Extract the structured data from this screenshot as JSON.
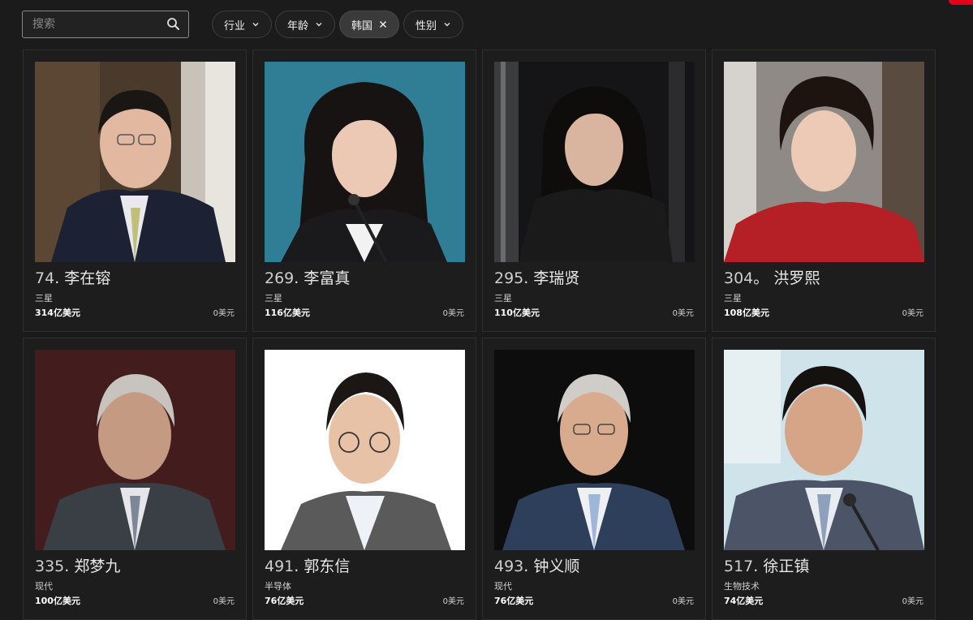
{
  "search": {
    "placeholder": "搜索",
    "value": ""
  },
  "filters": [
    {
      "label": "行业",
      "active": false
    },
    {
      "label": "年龄",
      "active": false
    },
    {
      "label": "韩国",
      "active": true
    },
    {
      "label": "性别",
      "active": false
    }
  ],
  "icons": {
    "search": "search-icon",
    "dropdown": "chevron-down-icon",
    "remove": "close-icon"
  },
  "colors": {
    "background": "#1b1b1b",
    "card_border": "#2f2f2f",
    "accent": "#e3001b"
  },
  "people": [
    {
      "rank": "74",
      "sep": ".",
      "name": "李在镕",
      "company": "三星",
      "net_worth": "314亿美元",
      "change": "0美元"
    },
    {
      "rank": "269",
      "sep": ".",
      "name": "李富真",
      "company": "三星",
      "net_worth": "116亿美元",
      "change": "0美元"
    },
    {
      "rank": "295",
      "sep": ".",
      "name": "李瑞贤",
      "company": "三星",
      "net_worth": "110亿美元",
      "change": "0美元"
    },
    {
      "rank": "304",
      "sep": "。",
      "name": "洪罗熙",
      "company": "三星",
      "net_worth": "108亿美元",
      "change": "0美元"
    },
    {
      "rank": "335",
      "sep": ".",
      "name": "郑梦九",
      "company": "现代",
      "net_worth": "100亿美元",
      "change": "0美元"
    },
    {
      "rank": "491",
      "sep": ".",
      "name": "郭东信",
      "company": "半导体",
      "net_worth": "76亿美元",
      "change": "0美元"
    },
    {
      "rank": "493",
      "sep": ".",
      "name": "钟义顺",
      "company": "现代",
      "net_worth": "76亿美元",
      "change": "0美元"
    },
    {
      "rank": "517",
      "sep": ".",
      "name": "徐正镇",
      "company": "生物技术",
      "net_worth": "74亿美元",
      "change": "0美元"
    }
  ]
}
